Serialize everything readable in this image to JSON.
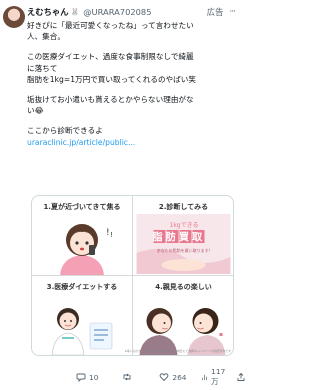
{
  "tweet": {
    "display_name": "えむちゃん",
    "handle": "@URARA702085",
    "ad_label": "広告",
    "lines": [
      "好きぴに「最近可愛くなったね」って言わせたい",
      "人、集合。"
    ],
    "paragraph2": [
      "この医療ダイエット、過度な食事制限なしで綺麗",
      "に落ちて",
      "脂肪を1kg=1万円で買い取ってくれるのやばい笑"
    ],
    "paragraph3": [
      "垢抜けてお小遣いも貰えるとかやらない理由がな",
      "い😂"
    ],
    "paragraph4": "ここから診断できるよ",
    "link": "uraraclinic.jp/article/public..."
  },
  "card": {
    "panels": [
      {
        "label": "1.夏が近づいてきて焦る"
      },
      {
        "label": "2.診断してみる",
        "banner_top": "1kgできる",
        "banner_big": "脂肪買取",
        "banner_sub": "あなたの脂肪を買い取ります!"
      },
      {
        "label": "3.医療ダイエットする"
      },
      {
        "label": "4.親見るの楽しい"
      }
    ],
    "fineprint": "※率いるのターン中に脂肪買取が成立した場合にて 無料キャンペーンの指定条件です"
  },
  "actions": {
    "replies": "10",
    "retweets": "",
    "likes": "264",
    "views": "117万"
  },
  "colors": {
    "link": "#1d9bf0",
    "muted": "#536471",
    "banner_pink": "#e9788f"
  }
}
